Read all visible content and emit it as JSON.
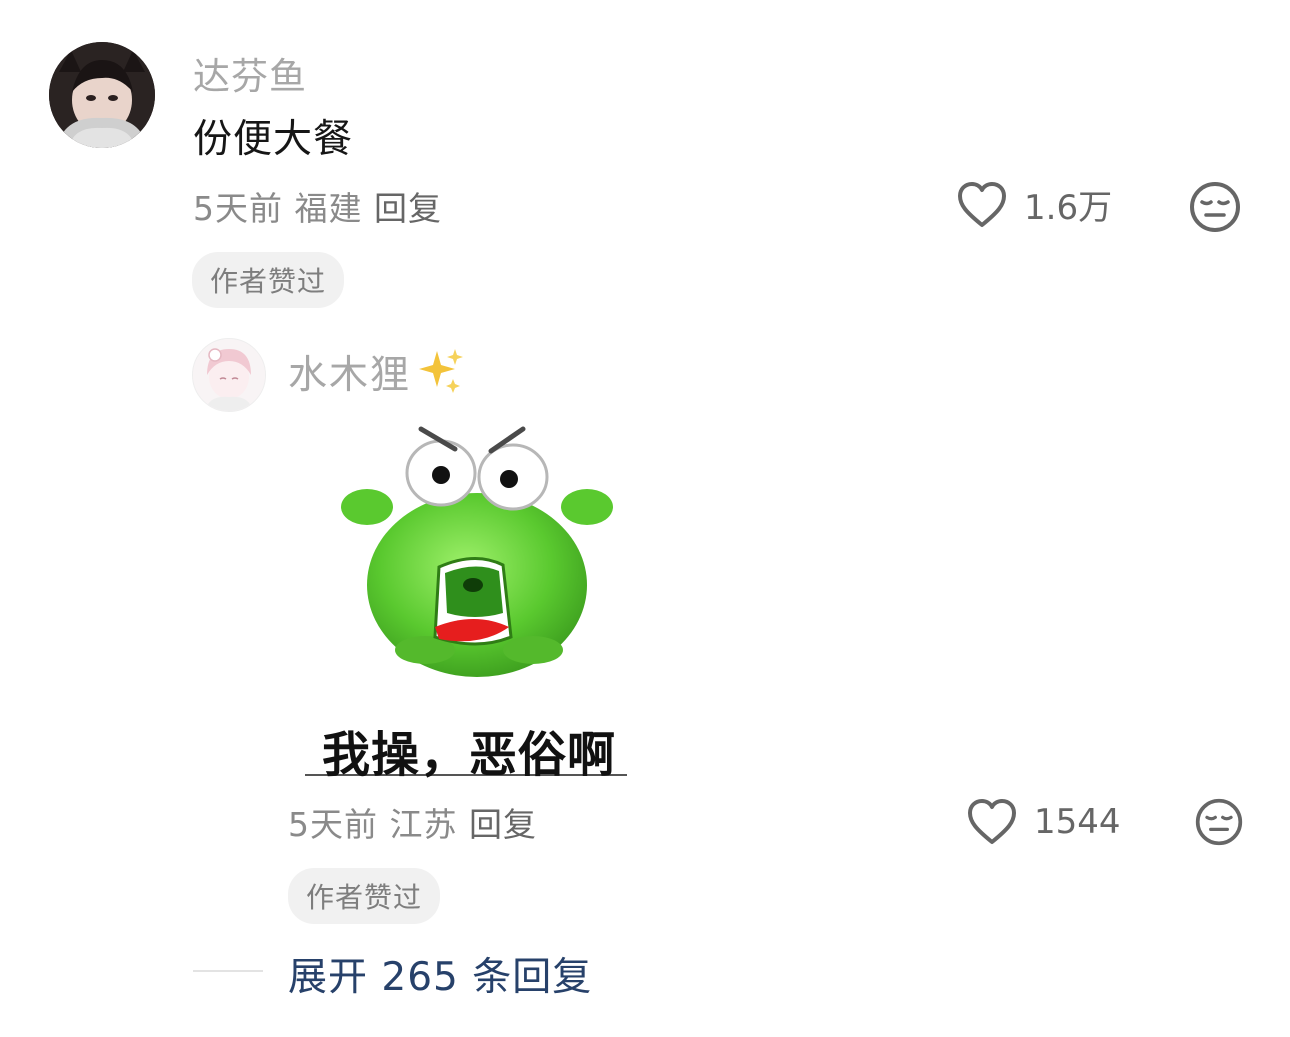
{
  "comment": {
    "username": "达芬鱼",
    "text": "份便大餐",
    "time": "5天前",
    "location": "福建",
    "reply_label": "回复",
    "like_count": "1.6万",
    "badge": "作者赞过"
  },
  "reply": {
    "username": "水木狸",
    "username_emoji": "✨",
    "sticker_caption": "我操，恶俗啊",
    "time": "5天前",
    "location": "江苏",
    "reply_label": "回复",
    "like_count": "1544",
    "badge": "作者赞过"
  },
  "expand": {
    "label": "展开 265 条回复"
  },
  "colors": {
    "username": "#a7a7a7",
    "meta": "#8a8a8a",
    "expand_link": "#27416a",
    "badge_bg": "#f1f1f1",
    "sticker_green": "#5ac92f"
  },
  "icons": [
    "heart-outline-icon",
    "meh-face-icon",
    "sparkles-icon"
  ]
}
